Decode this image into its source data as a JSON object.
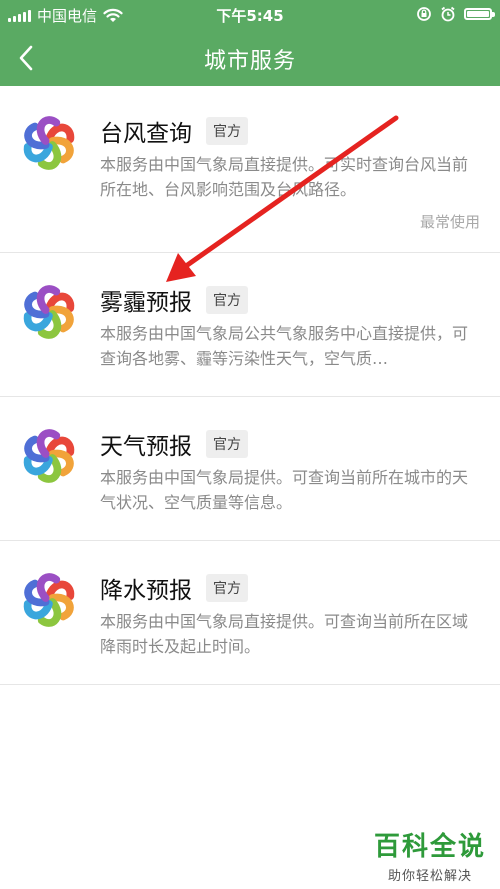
{
  "status_bar": {
    "carrier": "中国电信",
    "time": "下午5:45",
    "icons": [
      "signal-icon",
      "wifi-icon",
      "rotation-lock-icon",
      "alarm-icon",
      "battery-icon"
    ]
  },
  "nav": {
    "title": "城市服务",
    "back_icon": "chevron-left-icon"
  },
  "colors": {
    "header": "#5aaa63",
    "arrow": "#e52320",
    "watermark": "#2e9a3a"
  },
  "services": [
    {
      "name": "台风查询",
      "badge": "官方",
      "desc": "本服务由中国气象局直接提供。可实时查询台风当前所在地、台风影响范围及台风路径。",
      "tag": "最常使用"
    },
    {
      "name": "雾霾预报",
      "badge": "官方",
      "desc": "本服务由中国气象局公共气象服务中心直接提供，可查询各地雾、霾等污染性天气，空气质…",
      "tag": ""
    },
    {
      "name": "天气预报",
      "badge": "官方",
      "desc": "本服务由中国气象局提供。可查询当前所在城市的天气状况、空气质量等信息。",
      "tag": ""
    },
    {
      "name": "降水预报",
      "badge": "官方",
      "desc": "本服务由中国气象局直接提供。可查询当前所在区域降雨时长及起止时间。",
      "tag": ""
    }
  ],
  "watermark": {
    "title": "百科全说",
    "subtitle": "助你轻松解决"
  }
}
